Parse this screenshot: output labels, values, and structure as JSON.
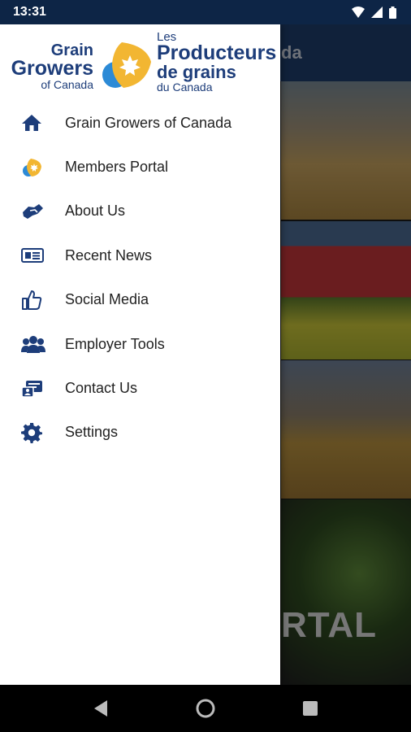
{
  "status_bar": {
    "time": "13:31"
  },
  "app": {
    "header_title_partial": "da",
    "tile_text_partial": "RTAL"
  },
  "drawer": {
    "logo": {
      "en_line1": "Grain",
      "en_line2": "Growers",
      "en_line3": "of Canada",
      "fr_line1": "Les",
      "fr_line2": "Producteurs",
      "fr_line3": "de grains",
      "fr_line4": "du Canada"
    },
    "items": [
      {
        "label": "Grain Growers of Canada",
        "icon": "home-icon"
      },
      {
        "label": "Members Portal",
        "icon": "members-portal-logo-icon"
      },
      {
        "label": "About Us",
        "icon": "handshake-icon"
      },
      {
        "label": "Recent News",
        "icon": "newspaper-icon"
      },
      {
        "label": "Social Media",
        "icon": "thumbs-up-icon"
      },
      {
        "label": "Employer Tools",
        "icon": "users-icon"
      },
      {
        "label": "Contact Us",
        "icon": "contact-card-icon"
      },
      {
        "label": "Settings",
        "icon": "gear-icon"
      }
    ]
  },
  "colors": {
    "accent": "#1d3d7a",
    "status_bar": "#0d2546",
    "gold": "#f2b632",
    "blue_leaf": "#2c8ad6"
  }
}
